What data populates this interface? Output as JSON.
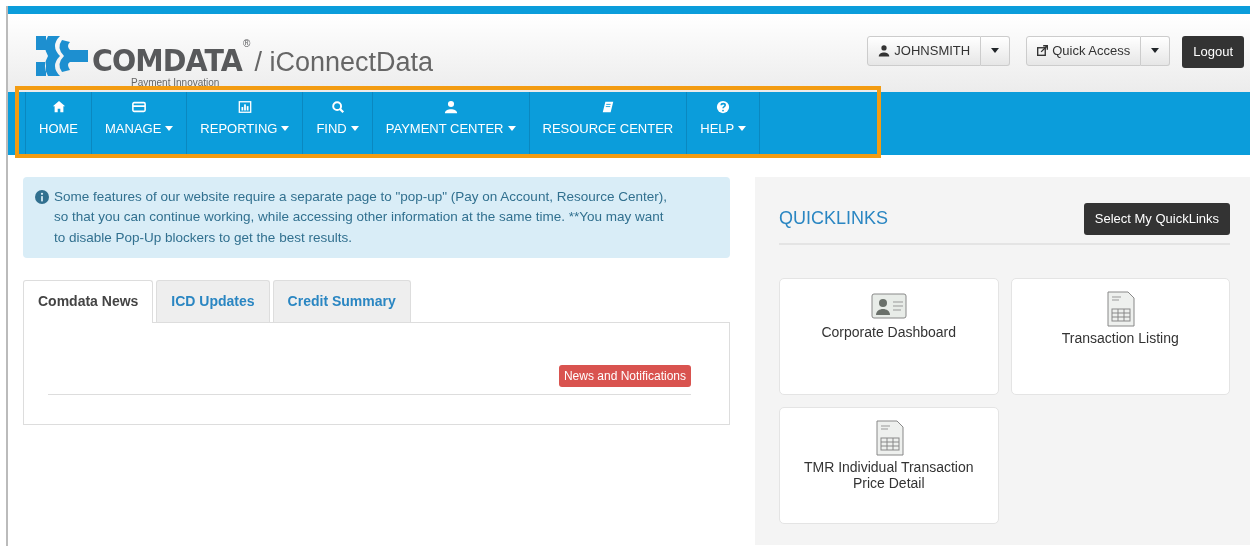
{
  "header": {
    "brand": "COMDATA",
    "registered": "®",
    "product": "/ iConnectData",
    "tagline": "Payment Innovation",
    "user_button": "JOHNSMITH",
    "quick_access": "Quick Access",
    "logout": "Logout"
  },
  "nav": {
    "highlighted": true,
    "items": [
      {
        "label": "HOME",
        "dropdown": false
      },
      {
        "label": "MANAGE",
        "dropdown": true
      },
      {
        "label": "REPORTING",
        "dropdown": true
      },
      {
        "label": "FIND",
        "dropdown": true
      },
      {
        "label": "PAYMENT CENTER",
        "dropdown": true
      },
      {
        "label": "RESOURCE CENTER",
        "dropdown": false
      },
      {
        "label": "HELP",
        "dropdown": true
      }
    ]
  },
  "alert": "Some features of our website require a separate page to \"pop-up\" (Pay on Account, Resource Center), so that you can continue working, while accessing other information at the same time. **You may want to disable Pop-Up blockers to get the best results.",
  "tabs": [
    {
      "label": "Comdata News",
      "selected": true
    },
    {
      "label": "ICD Updates",
      "selected": false
    },
    {
      "label": "Credit Summary",
      "selected": false
    }
  ],
  "news_badge": "News and Notifications",
  "quicklinks": {
    "title": "QUICKLINKS",
    "button": "Select My QuickLinks",
    "tiles": [
      {
        "label": "Corporate Dashboard"
      },
      {
        "label": "Transaction Listing"
      },
      {
        "label": "TMR Individual Transaction Price Detail"
      }
    ]
  }
}
